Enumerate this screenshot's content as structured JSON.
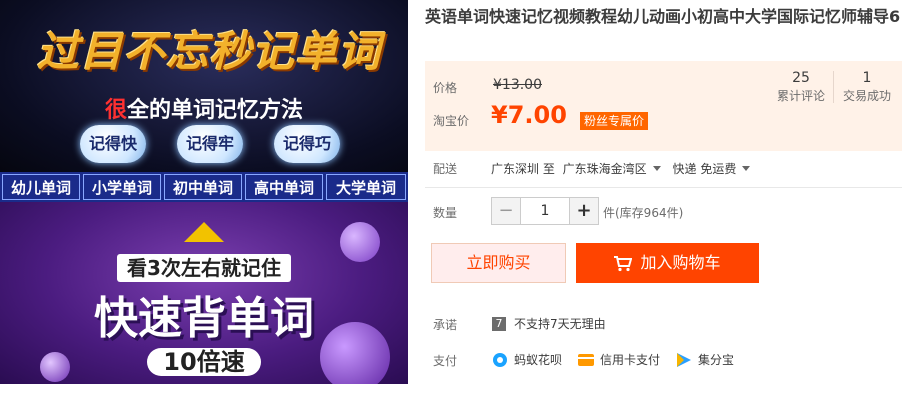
{
  "image": {
    "headline": "过目不忘秒记单词",
    "subtitle_red": "很",
    "subtitle_rest": "全的单词记忆方法",
    "bubbles": [
      "记得快",
      "记得牢",
      "记得巧"
    ],
    "tags": [
      "幼儿单词",
      "小学单词",
      "初中单词",
      "高中单词",
      "大学单词"
    ],
    "line1": "看3次左右就记住",
    "line2": "快速背单词",
    "line3": "10倍速"
  },
  "product": {
    "title": "英语单词快速记忆视频教程幼儿动画小初高中大学国际记忆师辅导6"
  },
  "price": {
    "label_price": "价格",
    "old_price": "¥13.00",
    "label_taobao": "淘宝价",
    "current_price": "¥7.00",
    "fan_badge": "粉丝专属价",
    "reviews_count": "25",
    "reviews_label": "累计评论",
    "deals_count": "1",
    "deals_label": "交易成功"
  },
  "shipping": {
    "label": "配送",
    "from": "广东深圳 至",
    "to": "广东珠海金湾区",
    "method": "快递 免运费"
  },
  "quantity": {
    "label": "数量",
    "minus": "−",
    "value": "1",
    "plus": "+",
    "stock": "件(库存964件)"
  },
  "actions": {
    "buy_now": "立即购买",
    "add_to_cart": "加入购物车"
  },
  "promise": {
    "label": "承诺",
    "icon_text": "7",
    "text": "不支持7天无理由"
  },
  "payment": {
    "label": "支付",
    "methods": [
      "蚂蚁花呗",
      "信用卡支付",
      "集分宝"
    ]
  },
  "colors": {
    "accent": "#ff4400",
    "price_bg": "#fff2e8",
    "badge": "#ff6600"
  }
}
